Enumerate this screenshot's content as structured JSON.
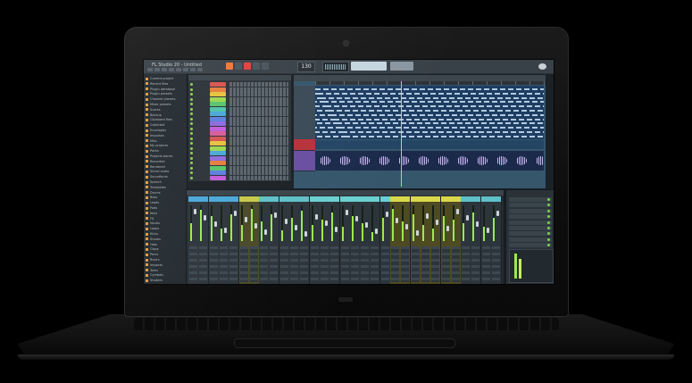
{
  "daw": {
    "window_title": "FL Studio 20 - Untitled",
    "tempo": "130",
    "browser_items": [
      "Current project",
      "Recent files",
      "Plugin database",
      "Plugin presets",
      "Channel presets",
      "Mixer presets",
      "Scores",
      "Backup",
      "Clipboard files",
      "Collected",
      "Envelopes",
      "Impulses",
      "Misc",
      "My projects",
      "Packs",
      "Projects bones",
      "Recorded",
      "Rendered",
      "Sliced audio",
      "Soundfonts",
      "Speech",
      "Templates",
      "Drums",
      "Bass",
      "Leads",
      "Pads",
      "Keys",
      "FX",
      "Vocals",
      "Loops",
      "Kicks",
      "Snares",
      "Hats",
      "Claps",
      "Percs",
      "Risers",
      "Impacts",
      "Toms",
      "Cymbals",
      "Shakers"
    ],
    "accent_color": "#f27733"
  }
}
